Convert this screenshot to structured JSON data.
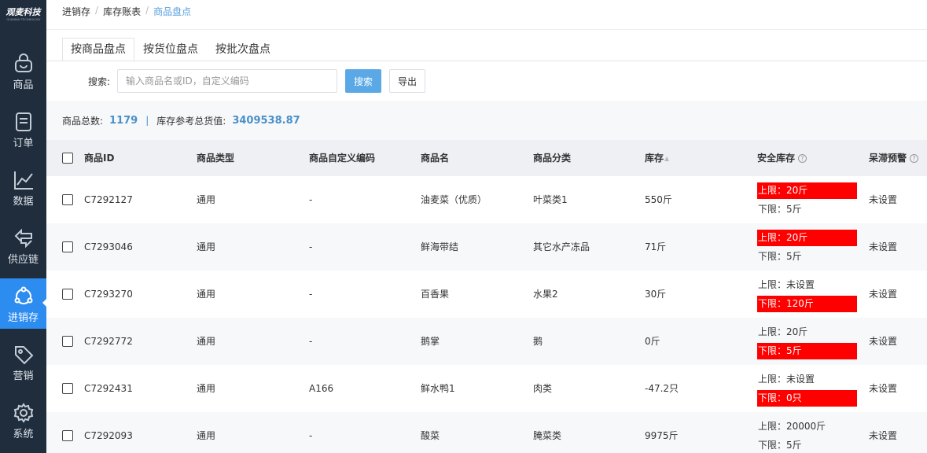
{
  "sidebar": {
    "logo_text": "观麦科技",
    "logo_sub": "GUANMAI TECHNOLOGY",
    "items": [
      {
        "label": "商品",
        "icon": "basket-icon"
      },
      {
        "label": "订单",
        "icon": "order-icon"
      },
      {
        "label": "数据",
        "icon": "chart-icon"
      },
      {
        "label": "供应链",
        "icon": "supply-chain-icon"
      },
      {
        "label": "进销存",
        "icon": "inventory-icon"
      },
      {
        "label": "营销",
        "icon": "tag-icon"
      },
      {
        "label": "系统",
        "icon": "gear-icon"
      }
    ],
    "active_index": 4
  },
  "breadcrumb": [
    "进销存",
    "库存账表",
    "商品盘点"
  ],
  "tabs": [
    "按商品盘点",
    "按货位盘点",
    "按批次盘点"
  ],
  "search": {
    "label": "搜索:",
    "placeholder": "输入商品名或ID，自定义编码",
    "value": "",
    "search_button": "搜索",
    "export_button": "导出"
  },
  "summary": {
    "total_label": "商品总数:",
    "total_value": "1179",
    "separator": "|",
    "value_label": "库存参考总货值:",
    "value_value": "3409538.87"
  },
  "table": {
    "headers": {
      "id": "商品ID",
      "type": "商品类型",
      "custom_code": "商品自定义编码",
      "name": "商品名",
      "category": "商品分类",
      "stock": "库存",
      "safe_stock": "安全库存",
      "stagnant": "呆滞预警"
    },
    "rows": [
      {
        "id": "C7292127",
        "type": "通用",
        "code": "-",
        "name": "油麦菜（优质）",
        "category": "叶菜类1",
        "stock": "550斤",
        "upper": "上限：20斤",
        "upper_warn": true,
        "lower": "下限：5斤",
        "lower_warn": false,
        "stagnant": "未设置"
      },
      {
        "id": "C7293046",
        "type": "通用",
        "code": "-",
        "name": "鲜海带结",
        "category": "其它水产冻品",
        "stock": "71斤",
        "upper": "上限：20斤",
        "upper_warn": true,
        "lower": "下限：5斤",
        "lower_warn": false,
        "stagnant": "未设置"
      },
      {
        "id": "C7293270",
        "type": "通用",
        "code": "-",
        "name": "百香果",
        "category": "水果2",
        "stock": "30斤",
        "upper": "上限：未设置",
        "upper_warn": false,
        "lower": "下限：120斤",
        "lower_warn": true,
        "stagnant": "未设置"
      },
      {
        "id": "C7292772",
        "type": "通用",
        "code": "-",
        "name": "鹅掌",
        "category": "鹅",
        "stock": "0斤",
        "upper": "上限：20斤",
        "upper_warn": false,
        "lower": "下限：5斤",
        "lower_warn": true,
        "stagnant": "未设置"
      },
      {
        "id": "C7292431",
        "type": "通用",
        "code": "A166",
        "name": "鲜水鸭1",
        "category": "肉类",
        "stock": "-47.2只",
        "upper": "上限：未设置",
        "upper_warn": false,
        "lower": "下限：0只",
        "lower_warn": true,
        "stagnant": "未设置"
      },
      {
        "id": "C7292093",
        "type": "通用",
        "code": "-",
        "name": "酸菜",
        "category": "腌菜类",
        "stock": "9975斤",
        "upper": "上限：20000斤",
        "upper_warn": false,
        "lower": "下限：5斤",
        "lower_warn": false,
        "stagnant": "未设置"
      }
    ]
  },
  "colors": {
    "sidebar_bg": "#1f2d3d",
    "active_nav": "#2d8cf0",
    "accent": "#5aa9e6",
    "warn": "#ff0000"
  }
}
